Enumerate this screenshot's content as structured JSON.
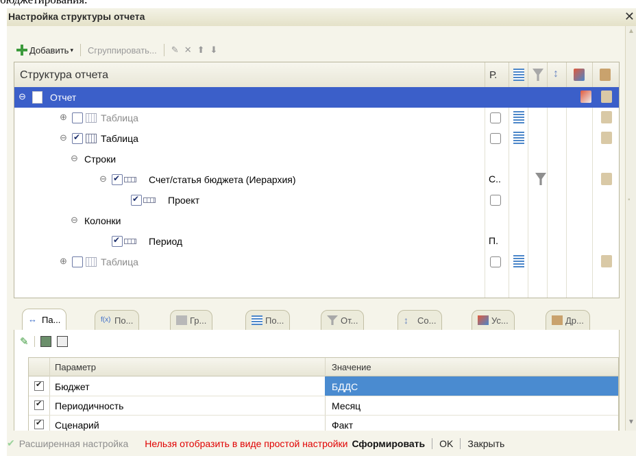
{
  "background_text": "бюджетирования.",
  "window": {
    "title": "Настройка структуры отчета"
  },
  "toolbar": {
    "add": "Добавить",
    "group": "Сгруппировать..."
  },
  "tree": {
    "header": "Структура отчета",
    "col_r": "Р.",
    "rows": [
      {
        "label": "Отчет",
        "col_r": ""
      },
      {
        "label": "Таблица",
        "col_r": ""
      },
      {
        "label": "Таблица",
        "col_r": ""
      },
      {
        "label": "Строки",
        "col_r": ""
      },
      {
        "label": "Счет/статья бюджета (Иерархия)",
        "col_r": "С.."
      },
      {
        "label": "Проект",
        "col_r": ""
      },
      {
        "label": "Колонки",
        "col_r": ""
      },
      {
        "label": "Период",
        "col_r": "П."
      },
      {
        "label": "Таблица",
        "col_r": ""
      }
    ]
  },
  "tabs": [
    "Па...",
    "По...",
    "Гр...",
    "По...",
    "От...",
    "Со...",
    "Ус...",
    "Др..."
  ],
  "params": {
    "col_param": "Параметр",
    "col_value": "Значение",
    "rows": [
      {
        "name": "Бюджет",
        "value": "БДДС"
      },
      {
        "name": "Периодичность",
        "value": "Месяц"
      },
      {
        "name": "Сценарий",
        "value": "Факт"
      }
    ]
  },
  "status": {
    "extended": "Расширенная настройка",
    "warning": "Нельзя отобразить в виде простой настройки",
    "generate": "Сформировать",
    "ok": "OK",
    "close": "Закрыть"
  }
}
